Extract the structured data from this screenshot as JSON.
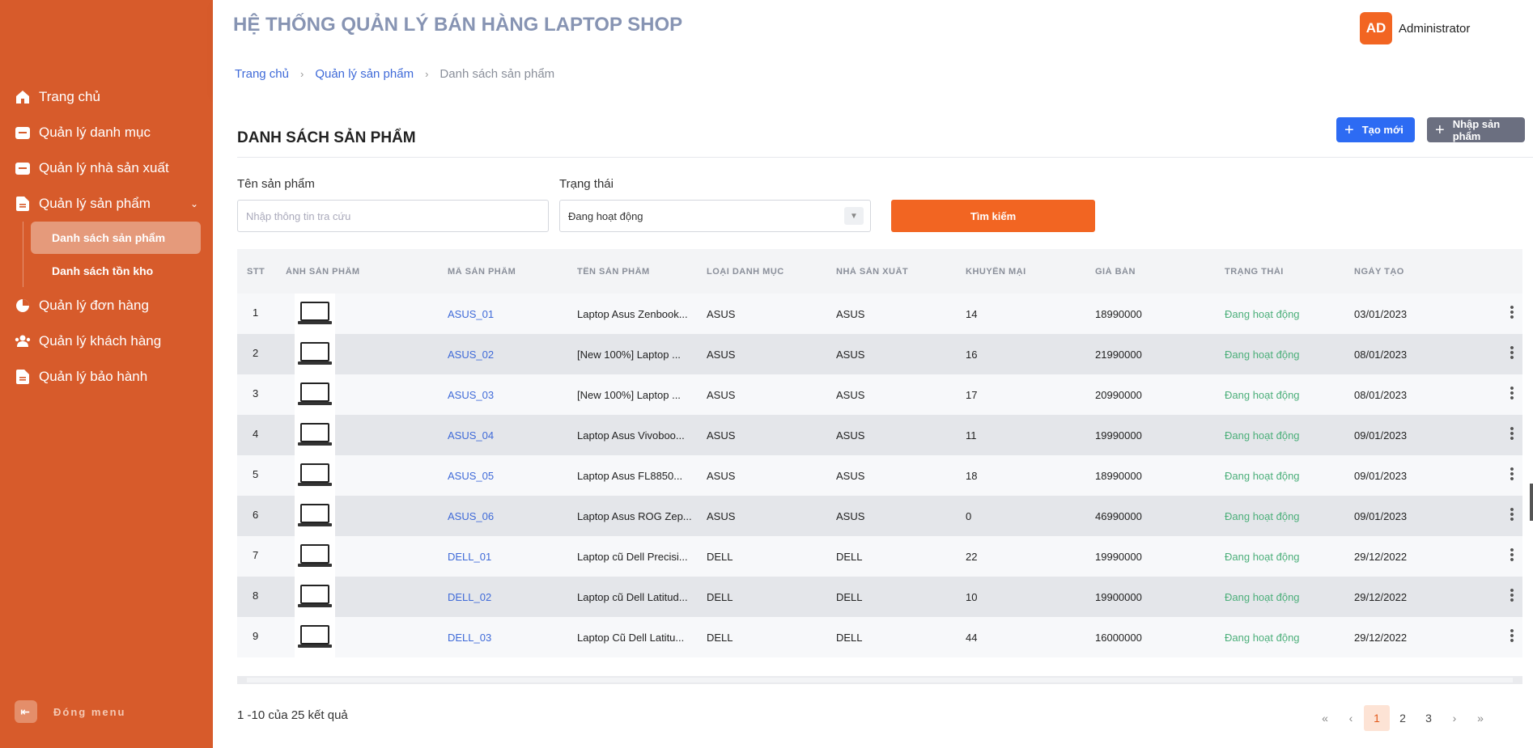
{
  "app": {
    "title": "HỆ THỐNG QUẢN LÝ BÁN HÀNG LAPTOP SHOP"
  },
  "user": {
    "initials": "AD",
    "name": "Administrator"
  },
  "breadcrumb": [
    "Trang chủ",
    "Quản lý sản phẩm",
    "Danh sách sản phẩm"
  ],
  "sidebar": {
    "items": [
      {
        "label": "Trang chủ",
        "icon": "home-icon"
      },
      {
        "label": "Quản lý danh mục",
        "icon": "folder-icon"
      },
      {
        "label": "Quản lý nhà sản xuất",
        "icon": "folder-icon"
      },
      {
        "label": "Quản lý sản phẩm",
        "icon": "document-icon"
      },
      {
        "label": "Quản lý đơn hàng",
        "icon": "pie-chart-icon"
      },
      {
        "label": "Quản lý khách hàng",
        "icon": "users-icon"
      },
      {
        "label": "Quản lý bảo hành",
        "icon": "document-icon"
      }
    ],
    "sub_items": [
      "Danh sách sản phẩm",
      "Danh sách tồn kho"
    ],
    "close_label": "Đóng menu"
  },
  "page": {
    "title": "DANH SÁCH SẢN PHẨM",
    "btn_new": "Tạo mới",
    "btn_import": "Nhập sản phẩm",
    "filter_name_label": "Tên sản phẩm",
    "filter_name_placeholder": "Nhập thông tin tra cứu",
    "filter_status_label": "Trạng thái",
    "filter_status_value": "Đang hoạt động",
    "btn_search": "Tìm kiếm"
  },
  "table": {
    "columns": [
      "STT",
      "ẢNH SẢN PHẨM",
      "MÃ SẢN PHẨM",
      "TÊN SẢN PHẨM",
      "LOẠI DANH MỤC",
      "NHÀ SẢN XUẤT",
      "KHUYẾN MẠI",
      "GIÁ BÁN",
      "TRẠNG THÁI",
      "NGÀY TẠO"
    ],
    "rows": [
      {
        "stt": "1",
        "code": "ASUS_01",
        "name": "Laptop Asus Zenbook...",
        "category": "ASUS",
        "maker": "ASUS",
        "discount": "14",
        "price": "18990000",
        "status": "Đang hoạt động",
        "date": "03/01/2023"
      },
      {
        "stt": "2",
        "code": "ASUS_02",
        "name": "[New 100%] Laptop ...",
        "category": "ASUS",
        "maker": "ASUS",
        "discount": "16",
        "price": "21990000",
        "status": "Đang hoạt động",
        "date": "08/01/2023"
      },
      {
        "stt": "3",
        "code": "ASUS_03",
        "name": "[New 100%] Laptop ...",
        "category": "ASUS",
        "maker": "ASUS",
        "discount": "17",
        "price": "20990000",
        "status": "Đang hoạt động",
        "date": "08/01/2023"
      },
      {
        "stt": "4",
        "code": "ASUS_04",
        "name": "Laptop Asus Vivoboo...",
        "category": "ASUS",
        "maker": "ASUS",
        "discount": "11",
        "price": "19990000",
        "status": "Đang hoạt động",
        "date": "09/01/2023"
      },
      {
        "stt": "5",
        "code": "ASUS_05",
        "name": "Laptop Asus FL8850...",
        "category": "ASUS",
        "maker": "ASUS",
        "discount": "18",
        "price": "18990000",
        "status": "Đang hoạt động",
        "date": "09/01/2023"
      },
      {
        "stt": "6",
        "code": "ASUS_06",
        "name": "Laptop Asus ROG Zep...",
        "category": "ASUS",
        "maker": "ASUS",
        "discount": "0",
        "price": "46990000",
        "status": "Đang hoạt động",
        "date": "09/01/2023"
      },
      {
        "stt": "7",
        "code": "DELL_01",
        "name": "Laptop cũ Dell Precisi...",
        "category": "DELL",
        "maker": "DELL",
        "discount": "22",
        "price": "19990000",
        "status": "Đang hoạt động",
        "date": "29/12/2022"
      },
      {
        "stt": "8",
        "code": "DELL_02",
        "name": "Laptop cũ Dell Latitud...",
        "category": "DELL",
        "maker": "DELL",
        "discount": "10",
        "price": "19900000",
        "status": "Đang hoạt động",
        "date": "29/12/2022"
      },
      {
        "stt": "9",
        "code": "DELL_03",
        "name": "Laptop Cũ Dell Latitu...",
        "category": "DELL",
        "maker": "DELL",
        "discount": "44",
        "price": "16000000",
        "status": "Đang hoạt động",
        "date": "29/12/2022"
      }
    ]
  },
  "footer": {
    "result_text": "1 -10 của 25 kết quả",
    "pages": [
      "1",
      "2",
      "3"
    ],
    "current_page": "1"
  },
  "colors": {
    "sidebar": "#d75b2b",
    "accent": "#f26522",
    "primary": "#2d6bf3",
    "status": "#4caf7a"
  }
}
